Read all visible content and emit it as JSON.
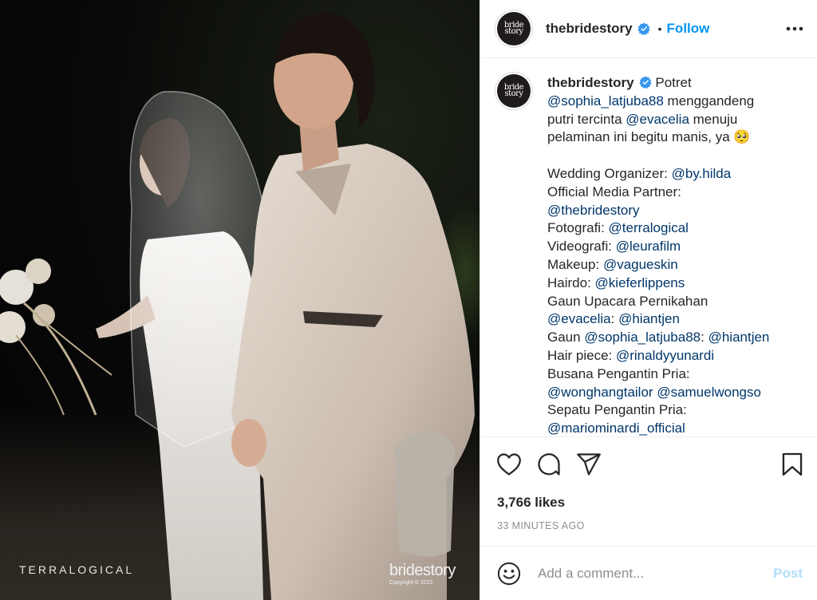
{
  "post": {
    "username": "thebridestory",
    "follow_label": "Follow",
    "separator": "•",
    "avatar_text_1": "bride",
    "avatar_text_2": "story"
  },
  "photo": {
    "watermark_left": "TERRALOGICAL",
    "watermark_right": "bridestory",
    "watermark_copyright": "Copyright © 2022"
  },
  "caption": {
    "username": "thebridestory",
    "lines": [
      [
        {
          "t": " Potret"
        }
      ],
      [
        {
          "t": "@sophia_latjuba88",
          "m": true
        },
        {
          "t": " menggandeng"
        }
      ],
      [
        {
          "t": "putri tercinta "
        },
        {
          "t": "@evacelia",
          "m": true
        },
        {
          "t": " menuju"
        }
      ],
      [
        {
          "t": "pelaminan ini begitu manis, ya 🥺"
        }
      ],
      [],
      [
        {
          "t": "Wedding Organizer: "
        },
        {
          "t": "@by.hilda",
          "m": true
        }
      ],
      [
        {
          "t": "Official Media Partner:"
        }
      ],
      [
        {
          "t": "@thebridestory",
          "m": true
        }
      ],
      [
        {
          "t": "Fotografi: "
        },
        {
          "t": "@terralogical",
          "m": true
        }
      ],
      [
        {
          "t": "Videografi: "
        },
        {
          "t": "@leurafilm",
          "m": true
        }
      ],
      [
        {
          "t": "Makeup: "
        },
        {
          "t": "@vagueskin",
          "m": true
        }
      ],
      [
        {
          "t": "Hairdo: "
        },
        {
          "t": "@kieferlippens",
          "m": true
        }
      ],
      [
        {
          "t": "Gaun Upacara Pernikahan"
        }
      ],
      [
        {
          "t": "@evacelia",
          "m": true
        },
        {
          "t": ": "
        },
        {
          "t": "@hiantjen",
          "m": true
        }
      ],
      [
        {
          "t": "Gaun "
        },
        {
          "t": "@sophia_latjuba88",
          "m": true
        },
        {
          "t": ": "
        },
        {
          "t": "@hiantjen",
          "m": true
        }
      ],
      [
        {
          "t": "Hair piece: "
        },
        {
          "t": "@rinaldyyunardi",
          "m": true
        }
      ],
      [
        {
          "t": "Busana Pengantin Pria:"
        }
      ],
      [
        {
          "t": "@wonghangtailor",
          "m": true
        },
        {
          "t": " "
        },
        {
          "t": "@samuelwongso",
          "m": true
        }
      ],
      [
        {
          "t": "Sepatu Pengantin Pria:"
        }
      ],
      [
        {
          "t": "@mariominardi_official",
          "m": true
        }
      ]
    ]
  },
  "stats": {
    "likes": "3,766 likes",
    "time": "33 MINUTES AGO"
  },
  "comment": {
    "placeholder": "Add a comment...",
    "post_label": "Post"
  },
  "colors": {
    "link": "#0095f6",
    "mention": "#00376b",
    "post_disabled": "#b2dffc"
  },
  "icons": [
    "verified-badge-icon",
    "more-options-icon",
    "heart-icon",
    "comment-icon",
    "share-icon",
    "bookmark-icon",
    "emoji-icon"
  ]
}
